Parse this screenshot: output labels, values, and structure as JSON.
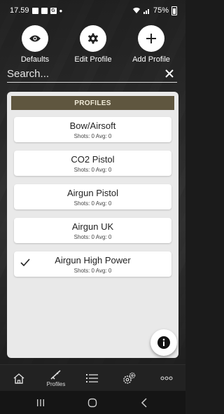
{
  "status_bar": {
    "time": "17.59",
    "battery": "75%"
  },
  "actions": [
    {
      "label": "Defaults",
      "icon": "eye-icon"
    },
    {
      "label": "Edit Profile",
      "icon": "gear-icon"
    },
    {
      "label": "Add Profile",
      "icon": "plus-icon"
    }
  ],
  "search": {
    "placeholder": "Search..."
  },
  "panel": {
    "header": "PROFILES",
    "profiles": [
      {
        "name": "Bow/Airsoft",
        "stats": "Shots: 0 Avg: 0",
        "selected": false
      },
      {
        "name": "CO2 Pistol",
        "stats": "Shots: 0 Avg: 0",
        "selected": false
      },
      {
        "name": "Airgun Pistol",
        "stats": "Shots: 0 Avg: 0",
        "selected": false
      },
      {
        "name": "Airgun UK",
        "stats": "Shots: 0 Avg: 0",
        "selected": false
      },
      {
        "name": "Airgun High Power",
        "stats": "Shots: 0 Avg: 0",
        "selected": true
      }
    ]
  },
  "tabbar": {
    "profiles_label": "Profiles"
  }
}
